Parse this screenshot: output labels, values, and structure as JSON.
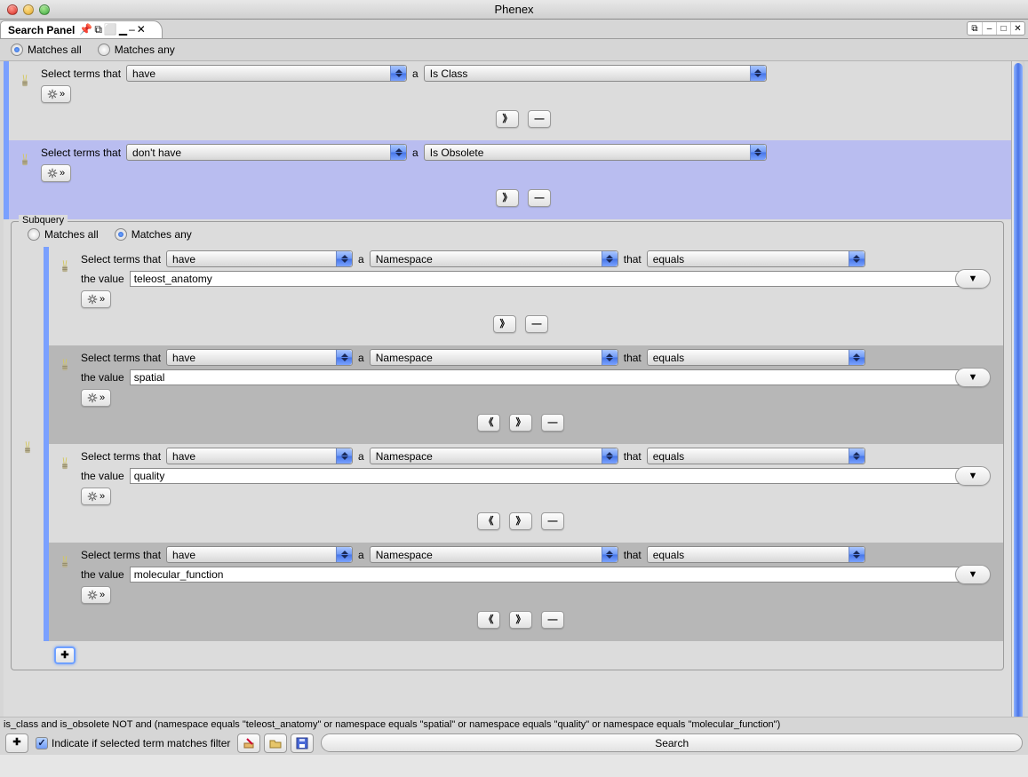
{
  "window": {
    "title": "Phenex"
  },
  "tab": {
    "label": "Search Panel"
  },
  "top": {
    "matches_all": "Matches all",
    "matches_any": "Matches any"
  },
  "rows": [
    {
      "prefix": "Select terms that",
      "verb": "have",
      "a": "a",
      "attr": "Is Class"
    },
    {
      "prefix": "Select terms that",
      "verb": "don't have",
      "a": "a",
      "attr": "Is Obsolete"
    }
  ],
  "subquery": {
    "legend": "Subquery",
    "matches_all": "Matches all",
    "matches_any": "Matches any",
    "rows": [
      {
        "prefix": "Select terms that",
        "verb": "have",
        "a": "a",
        "attr": "Namespace",
        "that": "that",
        "cmp": "equals",
        "the_value": "the value",
        "val": "teleost_anatomy"
      },
      {
        "prefix": "Select terms that",
        "verb": "have",
        "a": "a",
        "attr": "Namespace",
        "that": "that",
        "cmp": "equals",
        "the_value": "the value",
        "val": "spatial"
      },
      {
        "prefix": "Select terms that",
        "verb": "have",
        "a": "a",
        "attr": "Namespace",
        "that": "that",
        "cmp": "equals",
        "the_value": "the value",
        "val": "quality"
      },
      {
        "prefix": "Select terms that",
        "verb": "have",
        "a": "a",
        "attr": "Namespace",
        "that": "that",
        "cmp": "equals",
        "the_value": "the value",
        "val": "molecular_function"
      }
    ]
  },
  "summary": "is_class and is_obsolete NOT and (namespace equals \"teleost_anatomy\" or namespace equals \"spatial\" or namespace equals \"quality\" or namespace equals \"molecular_function\")",
  "bottom": {
    "indicate": "Indicate if selected term matches filter",
    "search": "Search"
  },
  "glyphs": {
    "indent_right": "》",
    "indent_left": "《",
    "minus": "—",
    "plus": "✚",
    "triangle_down": "▼",
    "dash": "–",
    "box": "□",
    "x": "✕",
    "double_right": "»"
  }
}
